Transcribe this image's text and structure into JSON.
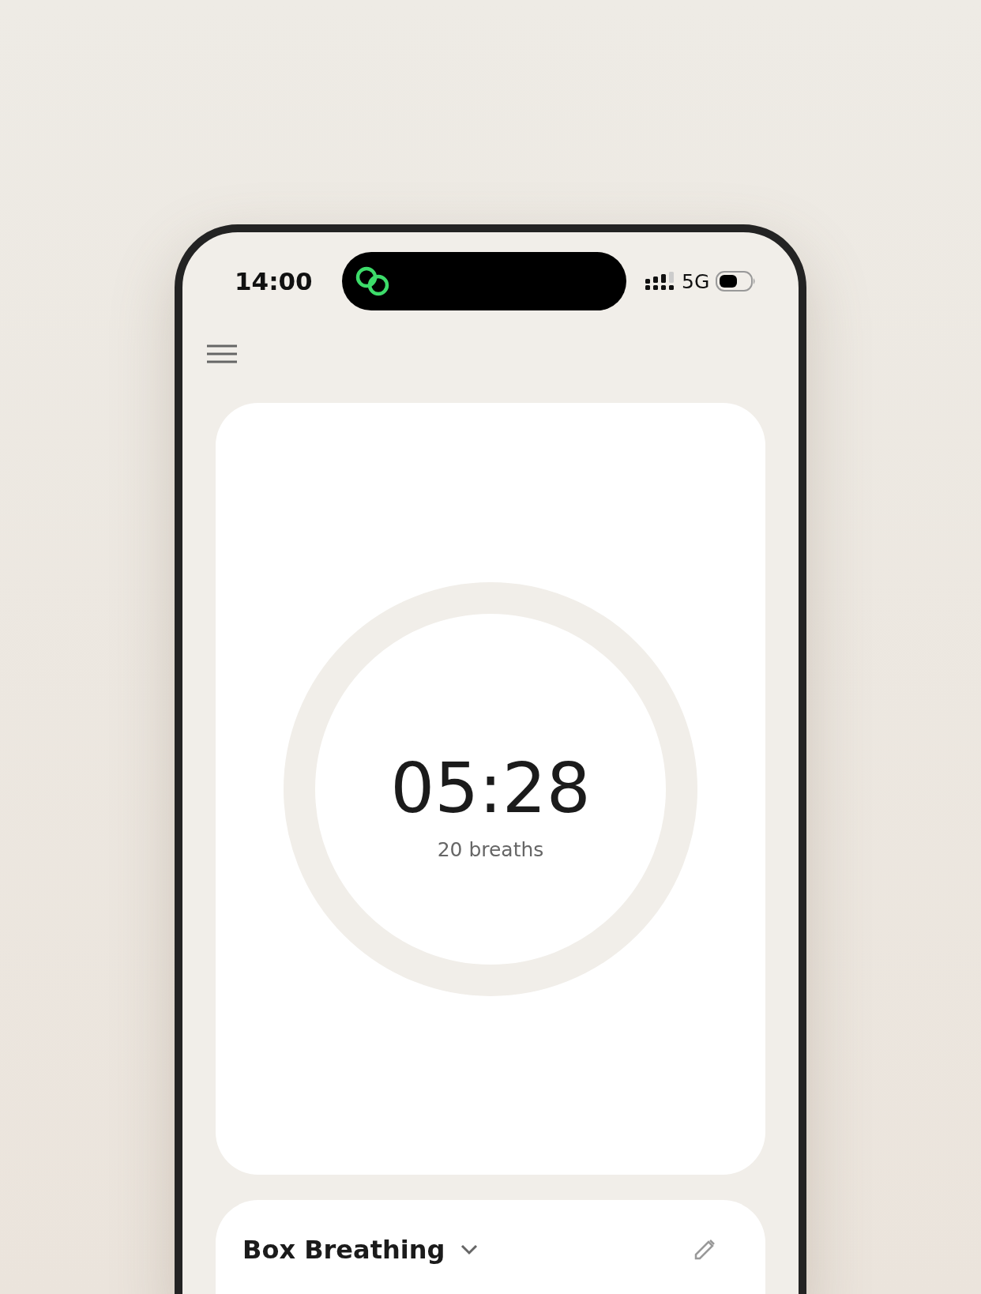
{
  "status_bar": {
    "time": "14:00",
    "network": "5G"
  },
  "timer": {
    "time": "05:28",
    "caption": "20 breaths"
  },
  "exercise": {
    "title": "Box Breathing"
  }
}
